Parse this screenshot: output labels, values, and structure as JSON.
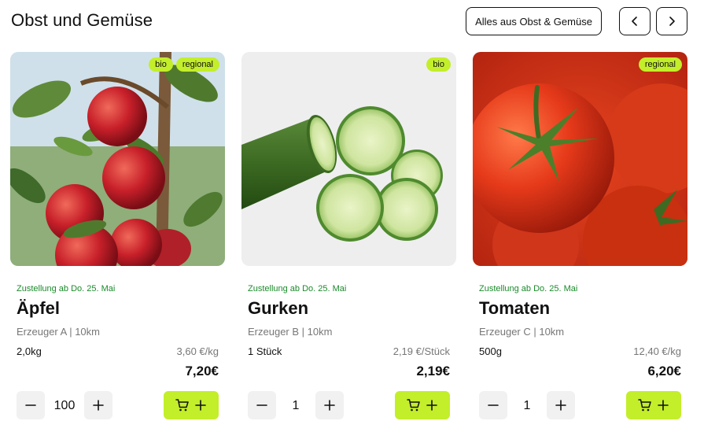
{
  "header": {
    "title": "Obst und Gemüse",
    "all_button": "Alles aus Obst & Gemüse"
  },
  "icons": {
    "prev": "chevron-left-icon",
    "next": "chevron-right-icon",
    "minus": "minus-icon",
    "plus": "plus-icon",
    "cart": "cart-icon"
  },
  "colors": {
    "accent": "#c3ee2a",
    "delivery_text": "#1a8a2a"
  },
  "products": [
    {
      "badges": [
        "bio",
        "regional"
      ],
      "delivery": "Zustellung ab Do. 25. Mai",
      "name": "Äpfel",
      "producer": "Erzeuger A | 10km",
      "quantity_unit": "2,0kg",
      "unit_price": "3,60 €/kg",
      "price": "7,20€",
      "quantity": "100"
    },
    {
      "badges": [
        "bio"
      ],
      "delivery": "Zustellung ab Do. 25. Mai",
      "name": "Gurken",
      "producer": "Erzeuger B | 10km",
      "quantity_unit": "1 Stück",
      "unit_price": "2,19 €/Stück",
      "price": "2,19€",
      "quantity": "1"
    },
    {
      "badges": [
        "regional"
      ],
      "delivery": "Zustellung ab Do. 25. Mai",
      "name": "Tomaten",
      "producer": "Erzeuger C | 10km",
      "quantity_unit": "500g",
      "unit_price": "12,40 €/kg",
      "price": "6,20€",
      "quantity": "1"
    }
  ]
}
